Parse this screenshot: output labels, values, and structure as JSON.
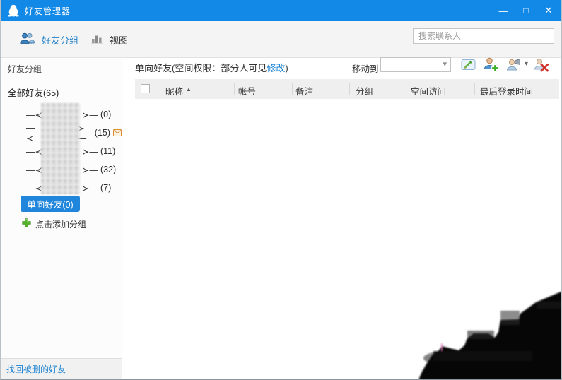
{
  "window": {
    "title": "好友管理器"
  },
  "icons": {
    "minimize": "—",
    "maximize": "□",
    "close": "✕",
    "combo_arrow": "▾",
    "rec_arrow": "▾",
    "sort_asc": "▲"
  },
  "toolbar": {
    "tab_groups": "好友分组",
    "tab_view": "视图",
    "search_placeholder": "搜索联系人"
  },
  "sidebar": {
    "header": "好友分组",
    "all_friends": "全部好友(65)",
    "group_prefix": "—≺",
    "group_suffix": "≻—",
    "groups": [
      {
        "count": "(0)"
      },
      {
        "count": "(15)"
      },
      {
        "count": "(11)"
      },
      {
        "count": "(32)"
      },
      {
        "count": "(7)"
      }
    ],
    "one_way_button": "单向好友(0)",
    "add_group": "点击添加分组",
    "recover_link": "找回被删的好友"
  },
  "main": {
    "header_prefix": "单向好友(空间权限：部分人可见",
    "header_link": "修改",
    "header_suffix": ")",
    "move_to": "移动到",
    "move_to_value": "",
    "columns": [
      "昵称",
      "帐号",
      "备注",
      "分组",
      "空间访问",
      "最后登录时间"
    ]
  },
  "colors": {
    "titlebar": "#1289e6",
    "tab_active": "#2080c8",
    "accent_link": "#1a82d2",
    "selected_bg": "#1f86dc"
  }
}
